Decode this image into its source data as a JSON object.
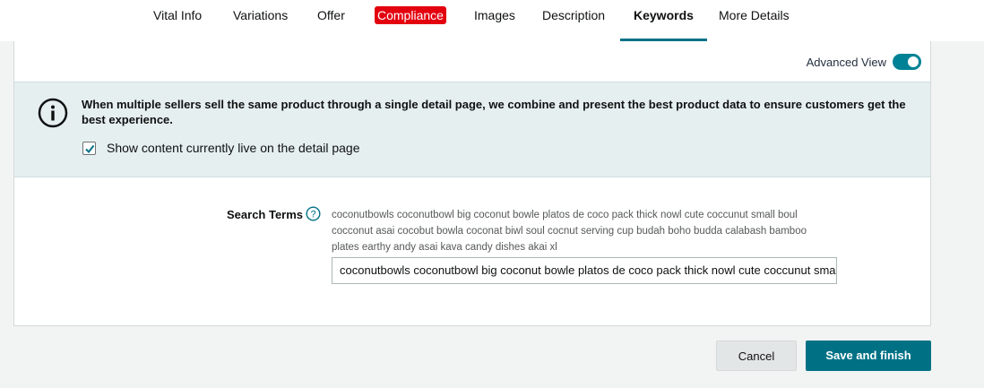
{
  "tabs": [
    {
      "label": "Vital Info"
    },
    {
      "label": "Variations"
    },
    {
      "label": "Offer"
    },
    {
      "label": "Compliance",
      "badge_color": "#e3000f"
    },
    {
      "label": "Images"
    },
    {
      "label": "Description"
    },
    {
      "label": "Keywords",
      "active": true
    },
    {
      "label": "More Details"
    }
  ],
  "advanced_view": {
    "label": "Advanced View",
    "enabled": true
  },
  "info": {
    "icon": "info-circle-icon",
    "message": "When multiple sellers sell the same product through a single detail page, we combine and present the best product data to ensure customers get the best experience.",
    "checkbox_label": "Show content currently live on the detail page",
    "checkbox_checked": true
  },
  "search_terms": {
    "label": "Search Terms",
    "help_icon": "question-circle-icon",
    "live_value": "coconutbowls coconutbowl big coconut bowle platos de coco pack thick nowl cute coccunut small boul cocconut asai cocobut bowla coconat biwl soul cocnut serving cup budah boho budda calabash bamboo plates earthy andy asai kava candy dishes akai xl",
    "input_value": "coconutbowls coconutbowl big coconut bowle platos de coco pack thick nowl cute coccunut small boul"
  },
  "buttons": {
    "cancel": "Cancel",
    "save": "Save and finish"
  },
  "colors": {
    "accent": "#007185",
    "info_bg": "#e6eff0",
    "toggle": "#008296"
  }
}
